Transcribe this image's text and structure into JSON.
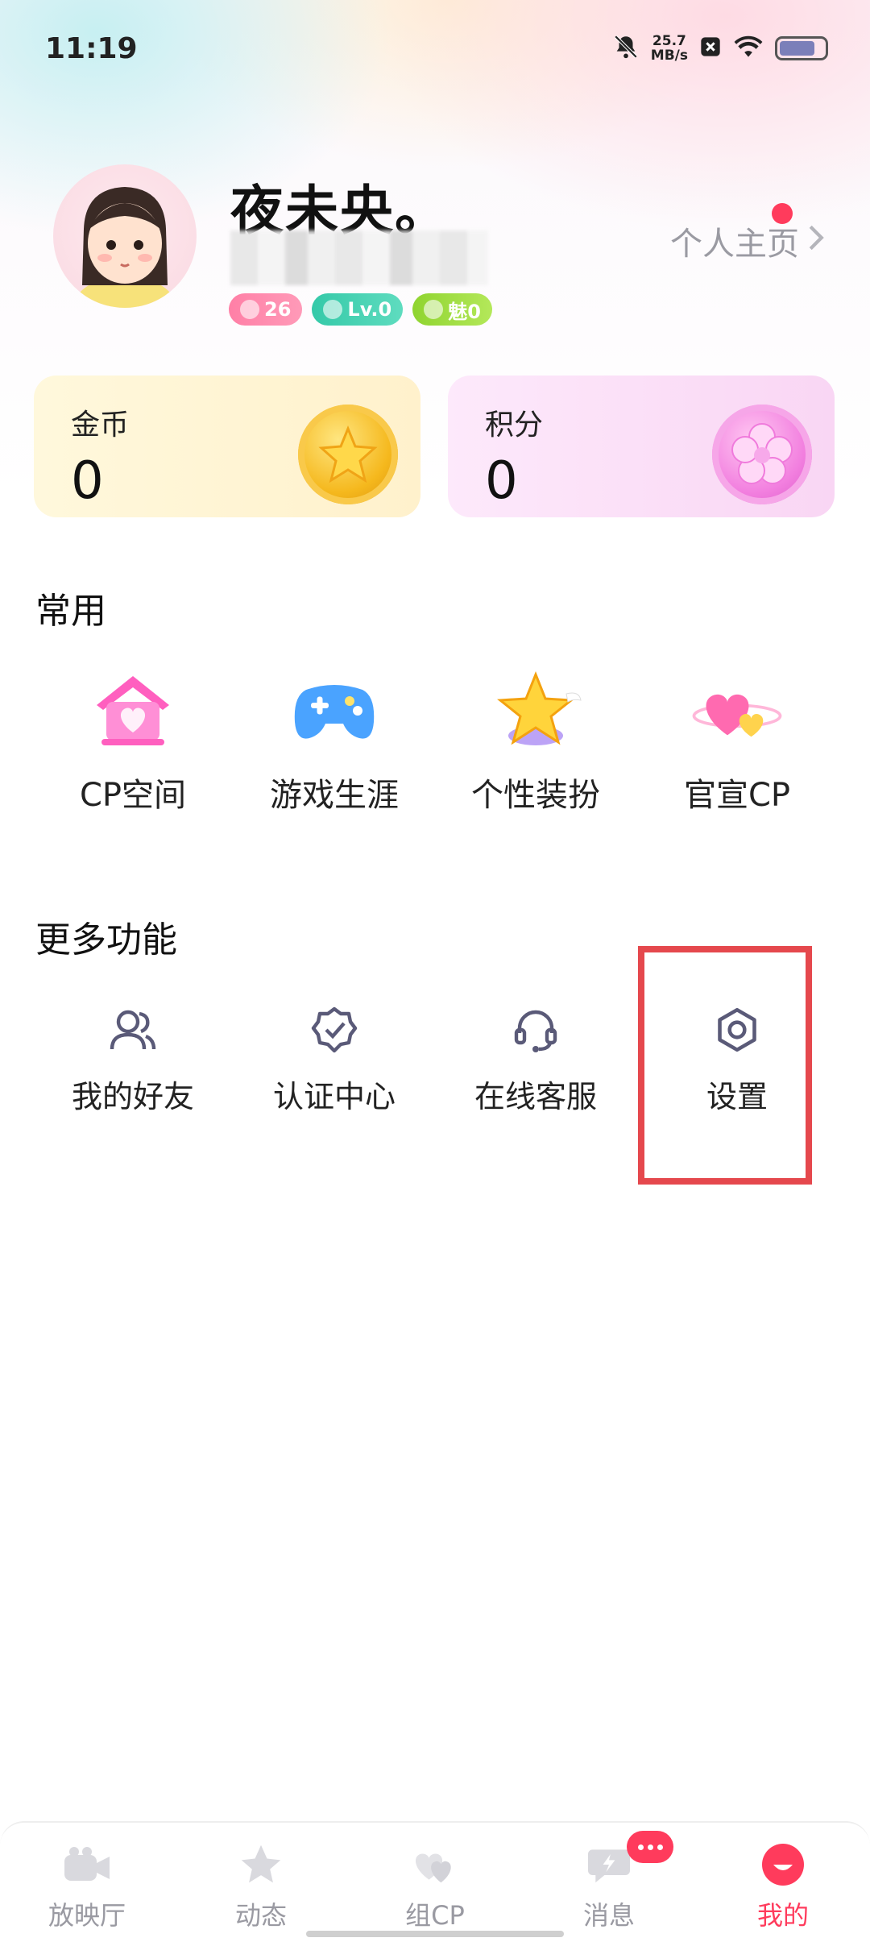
{
  "status_bar": {
    "time": "11:19",
    "net_speed_value": "25.7",
    "net_speed_unit": "MB/s",
    "icons": [
      "bell-muted-icon",
      "x-box-icon",
      "wifi-icon",
      "battery-icon"
    ]
  },
  "profile": {
    "nickname": "夜未央。",
    "badges": [
      {
        "text": "26",
        "color": "#ff8fb0"
      },
      {
        "text": "Lv.0",
        "color": "#3ccfae"
      },
      {
        "text": "魅0",
        "color": "#9ad83b"
      }
    ],
    "homepage_link": "个人主页"
  },
  "assets": {
    "gold": {
      "label": "金币",
      "value": "0"
    },
    "points": {
      "label": "积分",
      "value": "0"
    }
  },
  "common": {
    "title": "常用",
    "items": [
      {
        "label": "CP空间",
        "icon": "cp-house-icon"
      },
      {
        "label": "游戏生涯",
        "icon": "gamepad-icon"
      },
      {
        "label": "个性装扮",
        "icon": "star-icon"
      },
      {
        "label": "官宣CP",
        "icon": "hearts-planet-icon"
      }
    ]
  },
  "more": {
    "title": "更多功能",
    "items": [
      {
        "label": "我的好友",
        "icon": "friends-icon"
      },
      {
        "label": "认证中心",
        "icon": "verified-badge-icon"
      },
      {
        "label": "在线客服",
        "icon": "headset-icon"
      },
      {
        "label": "设置",
        "icon": "settings-hex-icon"
      }
    ]
  },
  "nav": {
    "items": [
      {
        "label": "放映厅",
        "icon": "camera-icon"
      },
      {
        "label": "动态",
        "icon": "star-nav-icon"
      },
      {
        "label": "组CP",
        "icon": "hearts-nav-icon"
      },
      {
        "label": "消息",
        "icon": "message-icon"
      },
      {
        "label": "我的",
        "icon": "me-icon"
      }
    ],
    "active": "我的"
  },
  "colors": {
    "accent": "#ff3b5c",
    "highlight": "#e5484d"
  }
}
